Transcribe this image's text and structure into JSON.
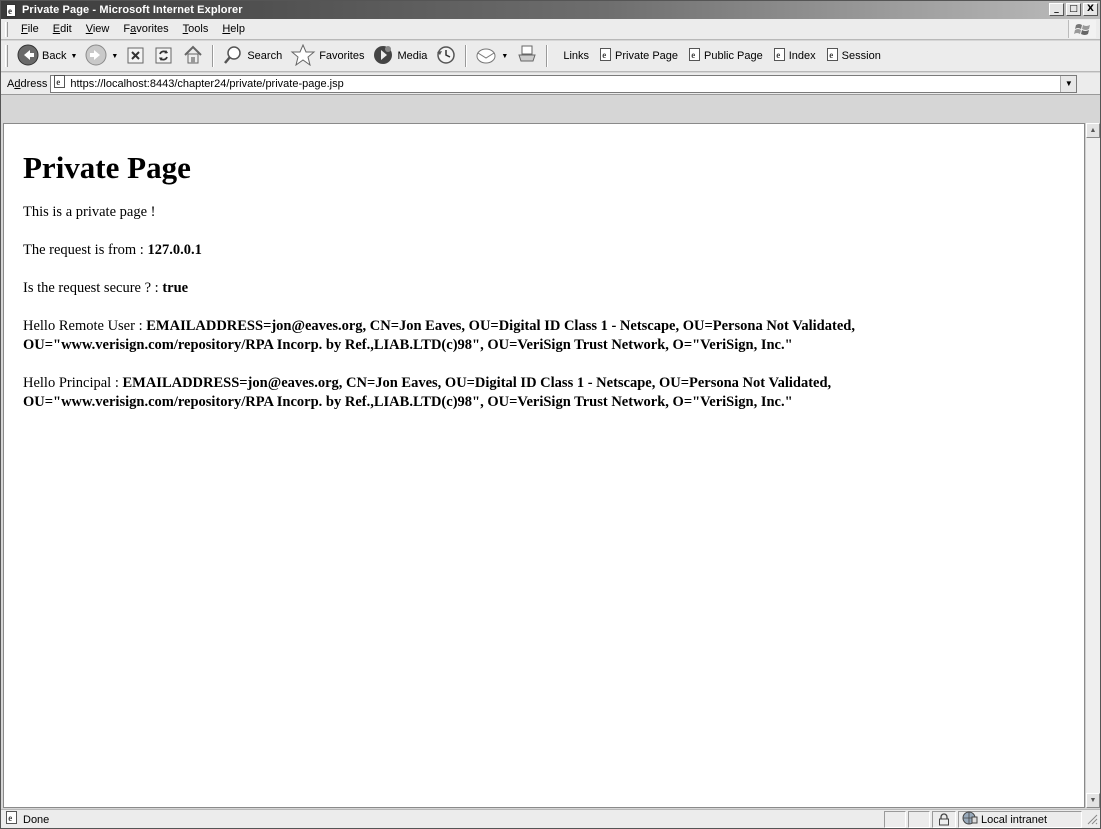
{
  "window": {
    "title": "Private Page - Microsoft Internet Explorer",
    "controls": {
      "minimize": "_",
      "maximize": "□",
      "close": "X"
    }
  },
  "menu": {
    "items": [
      {
        "label": "File",
        "key": "F",
        "rest": "ile"
      },
      {
        "label": "Edit",
        "key": "E",
        "rest": "dit"
      },
      {
        "label": "View",
        "key": "V",
        "rest": "iew"
      },
      {
        "label": "Favorites",
        "pre": "F",
        "key": "a",
        "rest": "vorites"
      },
      {
        "label": "Tools",
        "key": "T",
        "rest": "ools"
      },
      {
        "label": "Help",
        "key": "H",
        "rest": "elp"
      }
    ]
  },
  "toolbar": {
    "back_label": "Back",
    "search_label": "Search",
    "favorites_label": "Favorites",
    "media_label": "Media",
    "links_label": "Links",
    "links": [
      "Private Page",
      "Public Page",
      "Index",
      "Session"
    ]
  },
  "address": {
    "label_pre": "A",
    "label_key": "d",
    "label_rest": "dress",
    "url": "https://localhost:8443/chapter24/private/private-page.jsp"
  },
  "content": {
    "heading": "Private Page",
    "line1": "This is a private page !",
    "request_from_label": "The request is from : ",
    "request_from_value": "127.0.0.1",
    "secure_label": "Is the request secure ? : ",
    "secure_value": "true",
    "remote_user_label": "Hello Remote User : ",
    "remote_user_value_1": "EMAILADDRESS=jon@eaves.org, CN=Jon Eaves, OU=Digital ID Class 1 - Netscape, OU=Persona Not Validated,",
    "remote_user_value_2": "OU=\"www.verisign.com/repository/RPA Incorp. by Ref.,LIAB.LTD(c)98\", OU=VeriSign Trust Network, O=\"VeriSign, Inc.\"",
    "principal_label": "Hello Principal : ",
    "principal_value_1": "EMAILADDRESS=jon@eaves.org, CN=Jon Eaves, OU=Digital ID Class 1 - Netscape, OU=Persona Not Validated,",
    "principal_value_2": "OU=\"www.verisign.com/repository/RPA Incorp. by Ref.,LIAB.LTD(c)98\", OU=VeriSign Trust Network, O=\"VeriSign, Inc.\""
  },
  "status": {
    "text": "Done",
    "zone": "Local intranet"
  },
  "icons": {
    "app": "ie-page-icon",
    "back": "back-arrow-icon",
    "forward": "forward-arrow-icon",
    "stop": "stop-icon",
    "refresh": "refresh-icon",
    "home": "home-icon",
    "search": "search-icon",
    "favorites": "star-icon",
    "media": "media-icon",
    "history": "history-icon",
    "mail": "mail-icon",
    "print": "print-icon",
    "lock": "lock-icon",
    "zone": "intranet-icon",
    "throbber": "windows-flag-icon"
  }
}
